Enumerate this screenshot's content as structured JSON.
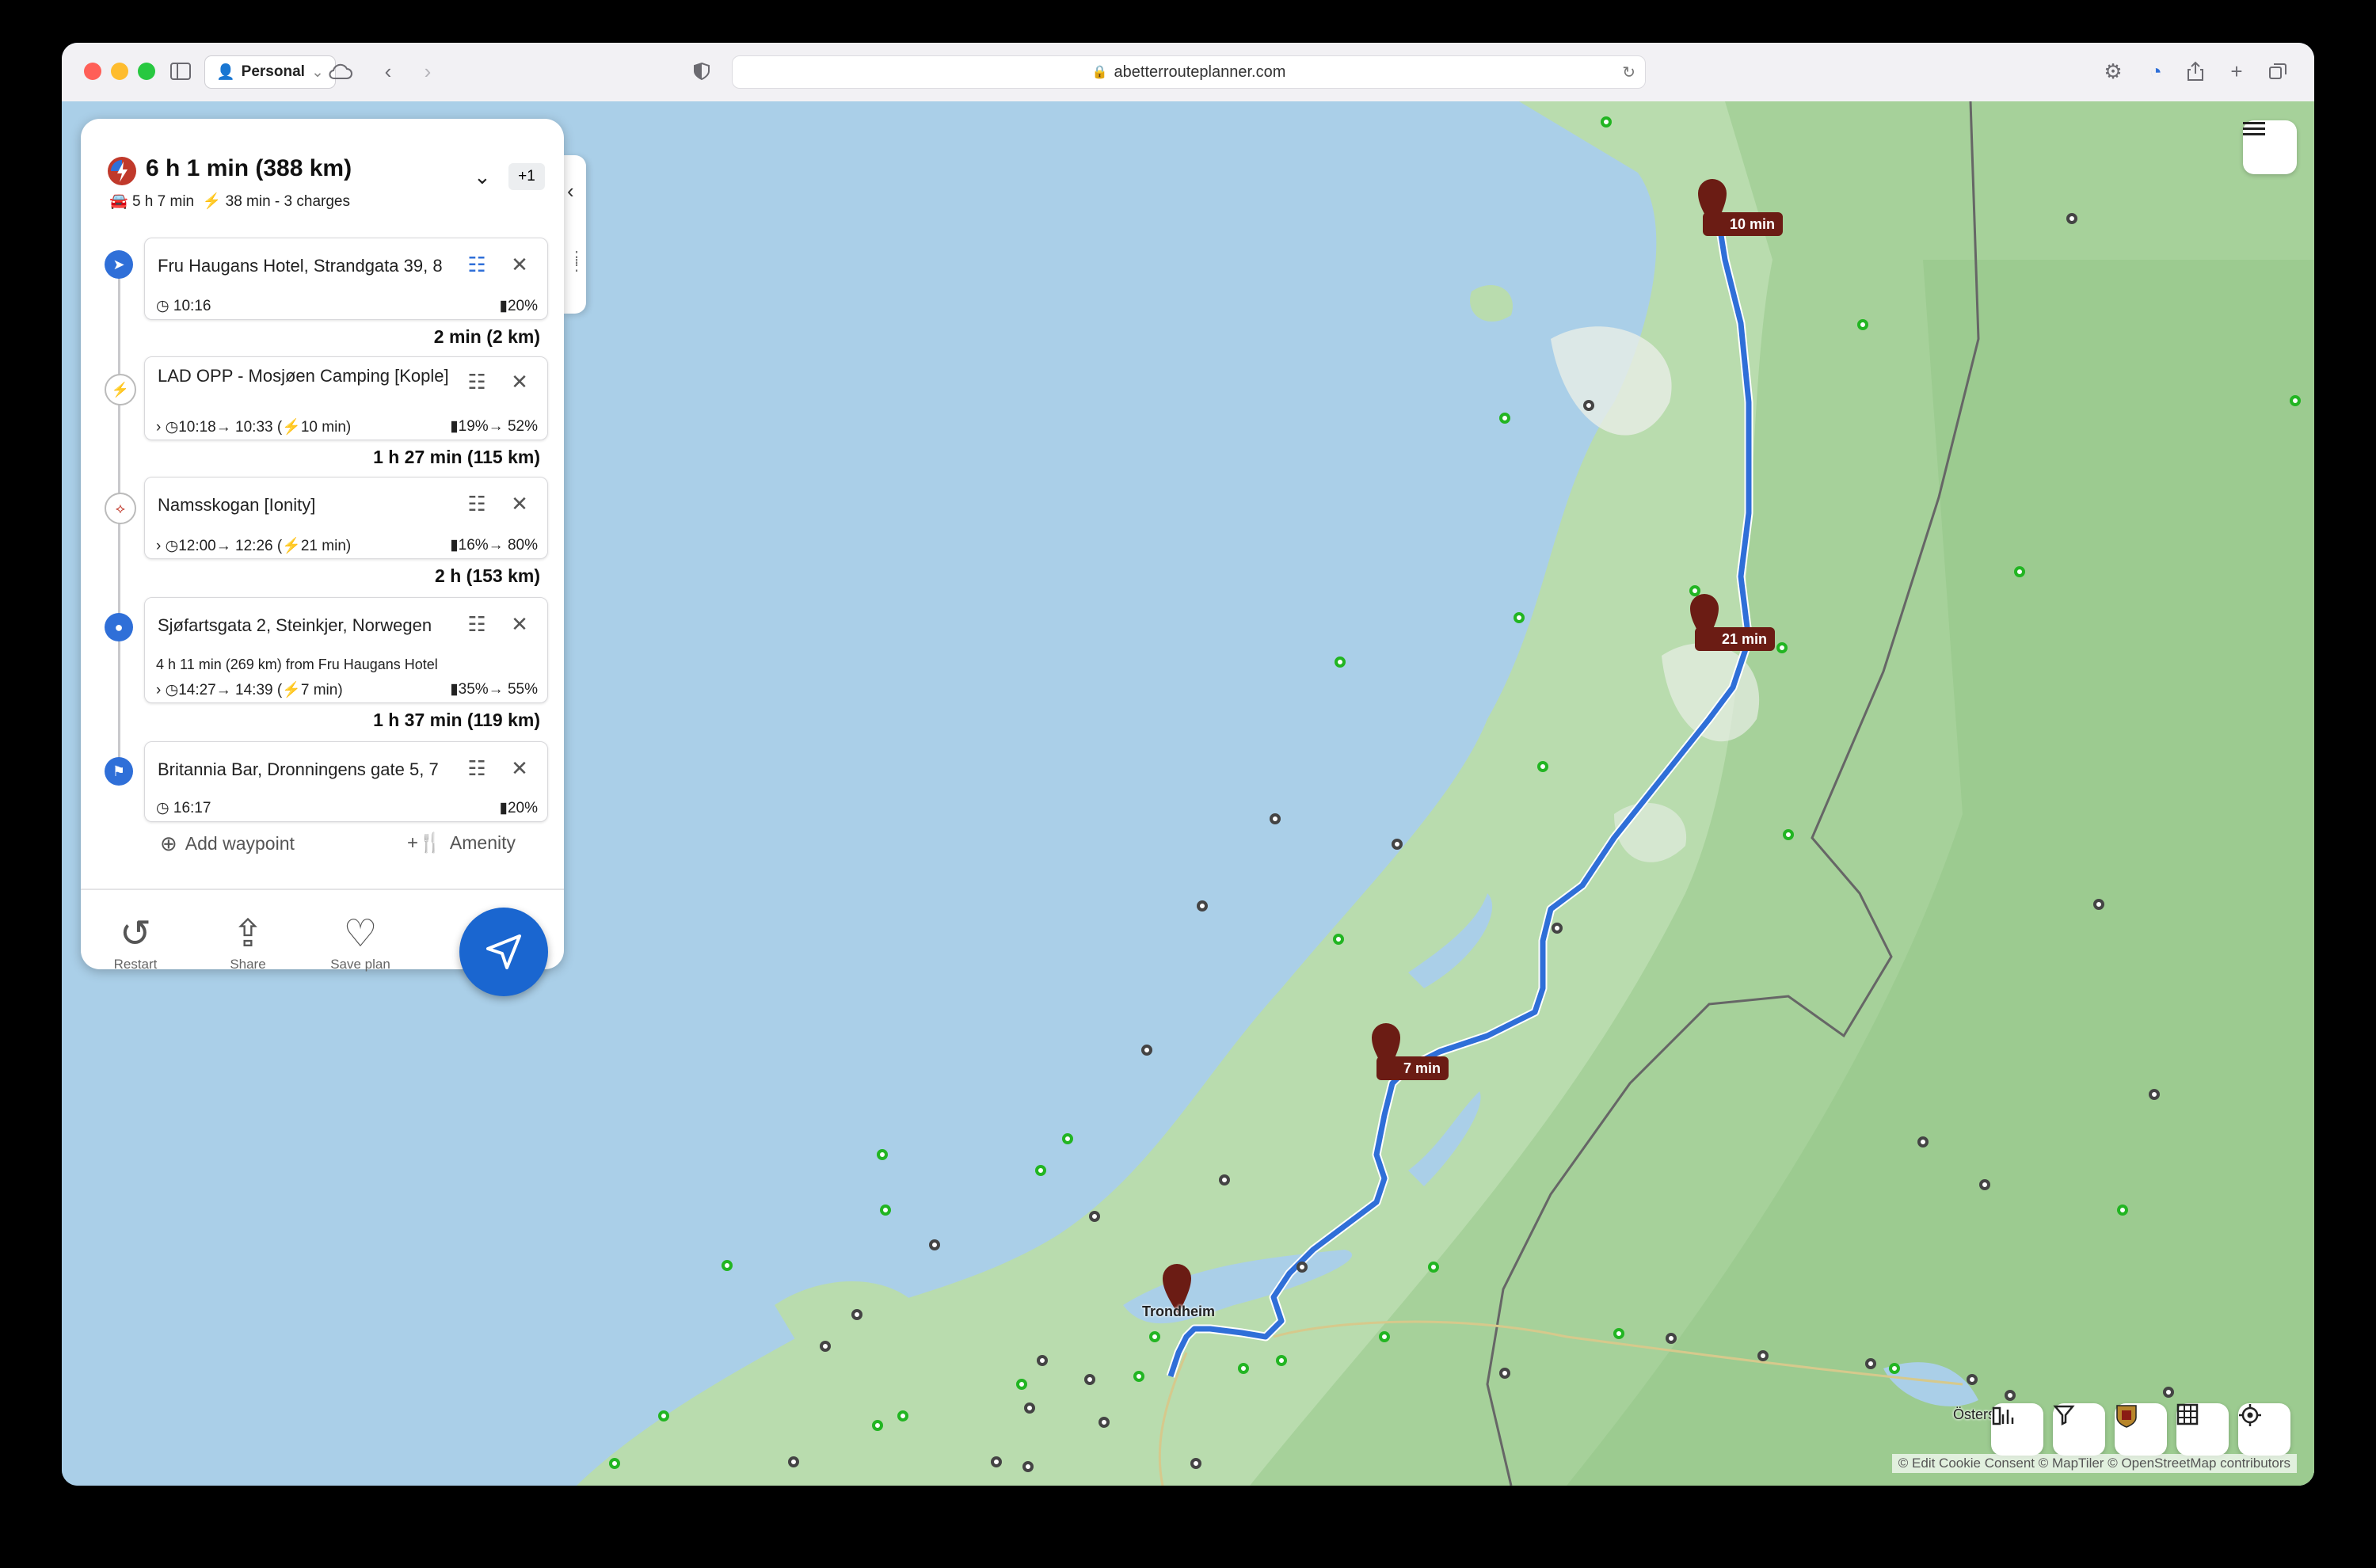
{
  "browser": {
    "profile": "Personal",
    "url": "abetterrouteplanner.com"
  },
  "route": {
    "total": "6 h 1 min (388 km)",
    "drive": "5 h 7 min",
    "charge": "38 min - 3 charges",
    "alt_badge": "+1"
  },
  "waypoints": [
    {
      "name": "Fru Haugans Hotel, Strandgata 39, 8",
      "time": "10:16",
      "soc": "20%"
    },
    {
      "name": "LAD OPP - Mosjøen Camping [Kople]",
      "time": "10:18→ 10:33 (",
      "charge_time": "10 min)",
      "soc": "19%→ 52%"
    },
    {
      "name": "Namsskogan [Ionity]",
      "time": "12:00→ 12:26 (",
      "charge_time": "21 min)",
      "soc": "16%→ 80%"
    },
    {
      "name": "Sjøfartsgata 2, Steinkjer, Norwegen",
      "detail": "4 h 11 min (269 km) from Fru Haugans Hotel",
      "time": "14:27→ 14:39 (",
      "charge_time": "7 min)",
      "soc": "35%→ 55%"
    },
    {
      "name": "Britannia Bar, Dronningens gate 5, 7",
      "time": "16:17",
      "soc": "20%"
    }
  ],
  "legs": [
    "2 min (2 km)",
    "1 h 27 min (115 km)",
    "2 h (153 km)",
    "1 h 37 min (119 km)"
  ],
  "actions": {
    "add_waypoint": "Add waypoint",
    "amenity": "Amenity",
    "restart": "Restart",
    "share": "Share",
    "save_plan": "Save plan"
  },
  "map": {
    "stops": [
      "10 min",
      "21 min",
      "7 min"
    ],
    "cities": [
      "Trondheim",
      "Östersund"
    ],
    "attribution": "© Edit Cookie Consent  © MapTiler  © OpenStreetMap contributors"
  },
  "colors": {
    "route": "#2f6fd8",
    "pin": "#6b1c14",
    "accent": "#1a66d0"
  }
}
